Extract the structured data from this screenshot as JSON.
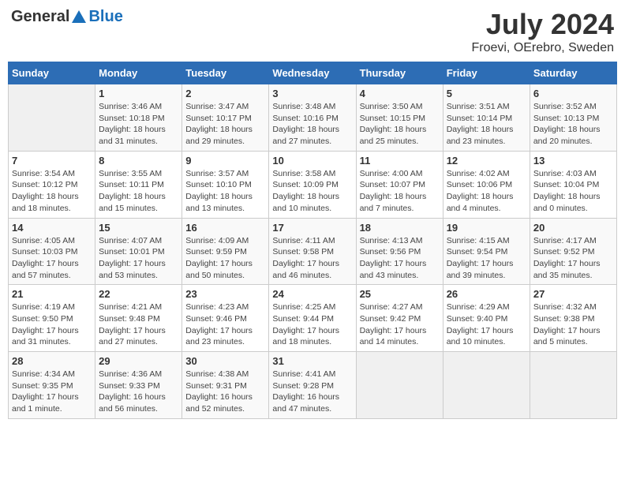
{
  "header": {
    "logo_general": "General",
    "logo_blue": "Blue",
    "month_year": "July 2024",
    "location": "Froevi, OErebro, Sweden"
  },
  "weekdays": [
    "Sunday",
    "Monday",
    "Tuesday",
    "Wednesday",
    "Thursday",
    "Friday",
    "Saturday"
  ],
  "weeks": [
    [
      {
        "day": "",
        "sunrise": "",
        "sunset": "",
        "daylight": ""
      },
      {
        "day": "1",
        "sunrise": "Sunrise: 3:46 AM",
        "sunset": "Sunset: 10:18 PM",
        "daylight": "Daylight: 18 hours and 31 minutes."
      },
      {
        "day": "2",
        "sunrise": "Sunrise: 3:47 AM",
        "sunset": "Sunset: 10:17 PM",
        "daylight": "Daylight: 18 hours and 29 minutes."
      },
      {
        "day": "3",
        "sunrise": "Sunrise: 3:48 AM",
        "sunset": "Sunset: 10:16 PM",
        "daylight": "Daylight: 18 hours and 27 minutes."
      },
      {
        "day": "4",
        "sunrise": "Sunrise: 3:50 AM",
        "sunset": "Sunset: 10:15 PM",
        "daylight": "Daylight: 18 hours and 25 minutes."
      },
      {
        "day": "5",
        "sunrise": "Sunrise: 3:51 AM",
        "sunset": "Sunset: 10:14 PM",
        "daylight": "Daylight: 18 hours and 23 minutes."
      },
      {
        "day": "6",
        "sunrise": "Sunrise: 3:52 AM",
        "sunset": "Sunset: 10:13 PM",
        "daylight": "Daylight: 18 hours and 20 minutes."
      }
    ],
    [
      {
        "day": "7",
        "sunrise": "Sunrise: 3:54 AM",
        "sunset": "Sunset: 10:12 PM",
        "daylight": "Daylight: 18 hours and 18 minutes."
      },
      {
        "day": "8",
        "sunrise": "Sunrise: 3:55 AM",
        "sunset": "Sunset: 10:11 PM",
        "daylight": "Daylight: 18 hours and 15 minutes."
      },
      {
        "day": "9",
        "sunrise": "Sunrise: 3:57 AM",
        "sunset": "Sunset: 10:10 PM",
        "daylight": "Daylight: 18 hours and 13 minutes."
      },
      {
        "day": "10",
        "sunrise": "Sunrise: 3:58 AM",
        "sunset": "Sunset: 10:09 PM",
        "daylight": "Daylight: 18 hours and 10 minutes."
      },
      {
        "day": "11",
        "sunrise": "Sunrise: 4:00 AM",
        "sunset": "Sunset: 10:07 PM",
        "daylight": "Daylight: 18 hours and 7 minutes."
      },
      {
        "day": "12",
        "sunrise": "Sunrise: 4:02 AM",
        "sunset": "Sunset: 10:06 PM",
        "daylight": "Daylight: 18 hours and 4 minutes."
      },
      {
        "day": "13",
        "sunrise": "Sunrise: 4:03 AM",
        "sunset": "Sunset: 10:04 PM",
        "daylight": "Daylight: 18 hours and 0 minutes."
      }
    ],
    [
      {
        "day": "14",
        "sunrise": "Sunrise: 4:05 AM",
        "sunset": "Sunset: 10:03 PM",
        "daylight": "Daylight: 17 hours and 57 minutes."
      },
      {
        "day": "15",
        "sunrise": "Sunrise: 4:07 AM",
        "sunset": "Sunset: 10:01 PM",
        "daylight": "Daylight: 17 hours and 53 minutes."
      },
      {
        "day": "16",
        "sunrise": "Sunrise: 4:09 AM",
        "sunset": "Sunset: 9:59 PM",
        "daylight": "Daylight: 17 hours and 50 minutes."
      },
      {
        "day": "17",
        "sunrise": "Sunrise: 4:11 AM",
        "sunset": "Sunset: 9:58 PM",
        "daylight": "Daylight: 17 hours and 46 minutes."
      },
      {
        "day": "18",
        "sunrise": "Sunrise: 4:13 AM",
        "sunset": "Sunset: 9:56 PM",
        "daylight": "Daylight: 17 hours and 43 minutes."
      },
      {
        "day": "19",
        "sunrise": "Sunrise: 4:15 AM",
        "sunset": "Sunset: 9:54 PM",
        "daylight": "Daylight: 17 hours and 39 minutes."
      },
      {
        "day": "20",
        "sunrise": "Sunrise: 4:17 AM",
        "sunset": "Sunset: 9:52 PM",
        "daylight": "Daylight: 17 hours and 35 minutes."
      }
    ],
    [
      {
        "day": "21",
        "sunrise": "Sunrise: 4:19 AM",
        "sunset": "Sunset: 9:50 PM",
        "daylight": "Daylight: 17 hours and 31 minutes."
      },
      {
        "day": "22",
        "sunrise": "Sunrise: 4:21 AM",
        "sunset": "Sunset: 9:48 PM",
        "daylight": "Daylight: 17 hours and 27 minutes."
      },
      {
        "day": "23",
        "sunrise": "Sunrise: 4:23 AM",
        "sunset": "Sunset: 9:46 PM",
        "daylight": "Daylight: 17 hours and 23 minutes."
      },
      {
        "day": "24",
        "sunrise": "Sunrise: 4:25 AM",
        "sunset": "Sunset: 9:44 PM",
        "daylight": "Daylight: 17 hours and 18 minutes."
      },
      {
        "day": "25",
        "sunrise": "Sunrise: 4:27 AM",
        "sunset": "Sunset: 9:42 PM",
        "daylight": "Daylight: 17 hours and 14 minutes."
      },
      {
        "day": "26",
        "sunrise": "Sunrise: 4:29 AM",
        "sunset": "Sunset: 9:40 PM",
        "daylight": "Daylight: 17 hours and 10 minutes."
      },
      {
        "day": "27",
        "sunrise": "Sunrise: 4:32 AM",
        "sunset": "Sunset: 9:38 PM",
        "daylight": "Daylight: 17 hours and 5 minutes."
      }
    ],
    [
      {
        "day": "28",
        "sunrise": "Sunrise: 4:34 AM",
        "sunset": "Sunset: 9:35 PM",
        "daylight": "Daylight: 17 hours and 1 minute."
      },
      {
        "day": "29",
        "sunrise": "Sunrise: 4:36 AM",
        "sunset": "Sunset: 9:33 PM",
        "daylight": "Daylight: 16 hours and 56 minutes."
      },
      {
        "day": "30",
        "sunrise": "Sunrise: 4:38 AM",
        "sunset": "Sunset: 9:31 PM",
        "daylight": "Daylight: 16 hours and 52 minutes."
      },
      {
        "day": "31",
        "sunrise": "Sunrise: 4:41 AM",
        "sunset": "Sunset: 9:28 PM",
        "daylight": "Daylight: 16 hours and 47 minutes."
      },
      {
        "day": "",
        "sunrise": "",
        "sunset": "",
        "daylight": ""
      },
      {
        "day": "",
        "sunrise": "",
        "sunset": "",
        "daylight": ""
      },
      {
        "day": "",
        "sunrise": "",
        "sunset": "",
        "daylight": ""
      }
    ]
  ]
}
